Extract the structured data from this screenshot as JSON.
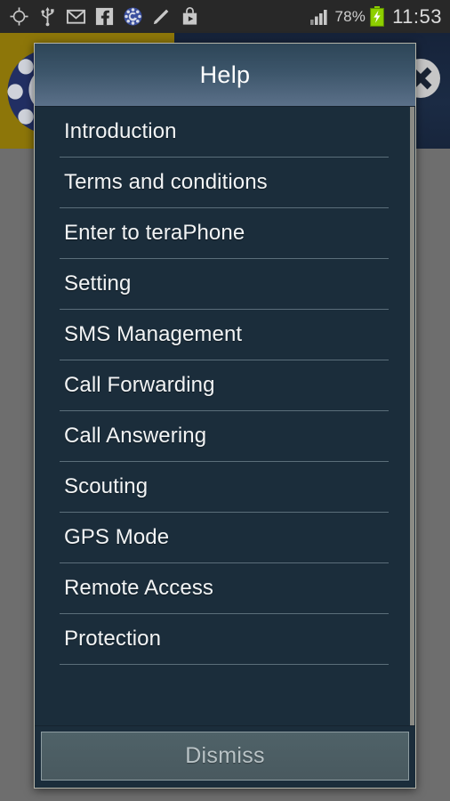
{
  "status_bar": {
    "icons": [
      {
        "name": "gps-crosshair-icon",
        "label": "GPS"
      },
      {
        "name": "usb-icon",
        "label": "USB"
      },
      {
        "name": "gmail-icon",
        "label": "Gmail"
      },
      {
        "name": "facebook-icon",
        "label": "Facebook"
      },
      {
        "name": "teraphone-dial-icon",
        "label": "teraPhone"
      },
      {
        "name": "pencil-icon",
        "label": "Edit"
      },
      {
        "name": "play-store-icon",
        "label": "Play Store"
      }
    ],
    "signal_icon": "signal-bars-icon",
    "battery_percent": "78%",
    "battery_icon": "battery-charging-icon",
    "clock": "11:53"
  },
  "background_app": {
    "logo_icon": "rotary-dial-logo-icon",
    "close_icon": "close-x-icon",
    "banner_color": "#8d7609",
    "banner_dark_color": "#1b2b44"
  },
  "dialog": {
    "title": "Help",
    "items": [
      {
        "label": "Introduction"
      },
      {
        "label": "Terms and conditions"
      },
      {
        "label": "Enter to teraPhone"
      },
      {
        "label": "Setting"
      },
      {
        "label": "SMS Management"
      },
      {
        "label": "Call Forwarding"
      },
      {
        "label": "Call Answering"
      },
      {
        "label": "Scouting"
      },
      {
        "label": "GPS Mode"
      },
      {
        "label": "Remote Access"
      },
      {
        "label": "Protection"
      }
    ],
    "dismiss_label": "Dismiss",
    "header_gradient_top": "#2d4557",
    "header_gradient_bottom": "#5b7089",
    "body_color": "#1b2d3b",
    "divider_color": "#5b6e7a"
  }
}
